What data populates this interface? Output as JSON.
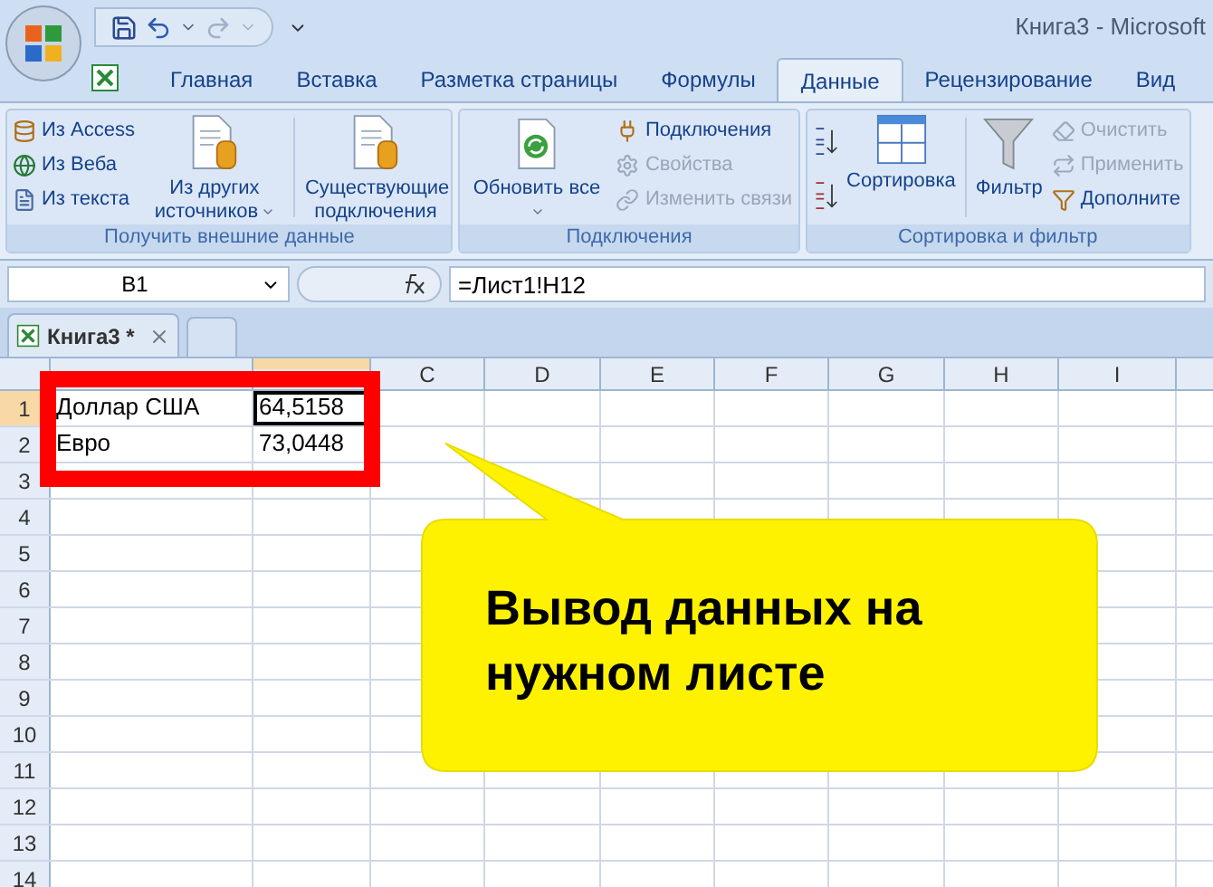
{
  "window": {
    "title": "Книга3 - Microsoft"
  },
  "ribbon_tabs": [
    {
      "label": "Главная",
      "selected": false
    },
    {
      "label": "Вставка",
      "selected": false
    },
    {
      "label": "Разметка страницы",
      "selected": false
    },
    {
      "label": "Формулы",
      "selected": false
    },
    {
      "label": "Данные",
      "selected": true
    },
    {
      "label": "Рецензирование",
      "selected": false
    },
    {
      "label": "Вид",
      "selected": false
    }
  ],
  "ribbon_groups": [
    {
      "title": "Получить внешние данные",
      "items": [
        {
          "kind": "stack",
          "items": [
            {
              "label": "Из Access",
              "disabled": false
            },
            {
              "label": "Из Веба",
              "disabled": false
            },
            {
              "label": "Из текста",
              "disabled": false
            }
          ]
        },
        {
          "kind": "large",
          "label": "Из других источников",
          "dropdown": true
        },
        {
          "kind": "separator"
        },
        {
          "kind": "large",
          "label": "Существующие подключения",
          "dropdown": false
        }
      ]
    },
    {
      "title": "Подключения",
      "items": [
        {
          "kind": "large",
          "label": "Обновить все",
          "dropdown": true
        },
        {
          "kind": "stack",
          "items": [
            {
              "label": "Подключения",
              "disabled": false
            },
            {
              "label": "Свойства",
              "disabled": true
            },
            {
              "label": "Изменить связи",
              "disabled": true
            }
          ]
        }
      ]
    },
    {
      "title": "Сортировка и фильтр",
      "items": [
        {
          "kind": "sort"
        },
        {
          "kind": "large",
          "label": "Сортировка",
          "dropdown": false
        },
        {
          "kind": "separator"
        },
        {
          "kind": "large",
          "label": "Фильтр",
          "dropdown": false
        },
        {
          "kind": "stack",
          "items": [
            {
              "label": "Очистить",
              "disabled": true
            },
            {
              "label": "Применить",
              "disabled": true
            },
            {
              "label": "Дополните",
              "disabled": false
            }
          ]
        }
      ]
    }
  ],
  "formula_bar": {
    "name_box": "B1",
    "formula": "=Лист1!H12"
  },
  "workbook_tab": {
    "title": "Книга3 *"
  },
  "sheet": {
    "columns": [
      {
        "label": "C"
      },
      {
        "label": "D"
      },
      {
        "label": "E"
      },
      {
        "label": "F"
      },
      {
        "label": "G"
      },
      {
        "label": "H"
      },
      {
        "label": "I"
      }
    ],
    "rows": [
      {
        "number": "1",
        "cells": [
          {
            "text": "Доллар США",
            "selected": false
          },
          {
            "text": "64,5158",
            "selected": true
          }
        ]
      },
      {
        "number": "2",
        "cells": [
          {
            "text": "Евро",
            "selected": false
          },
          {
            "text": "73,0448",
            "selected": false
          }
        ]
      },
      {
        "number": "3",
        "cells": []
      },
      {
        "number": "4",
        "cells": []
      },
      {
        "number": "5",
        "cells": []
      },
      {
        "number": "6",
        "cells": []
      },
      {
        "number": "7",
        "cells": []
      },
      {
        "number": "8",
        "cells": []
      },
      {
        "number": "9",
        "cells": []
      },
      {
        "number": "10",
        "cells": []
      },
      {
        "number": "11",
        "cells": []
      },
      {
        "number": "12",
        "cells": []
      },
      {
        "number": "13",
        "cells": []
      },
      {
        "number": "14",
        "cells": []
      }
    ]
  },
  "callout": {
    "text": "Вывод данных на нужном листе"
  }
}
